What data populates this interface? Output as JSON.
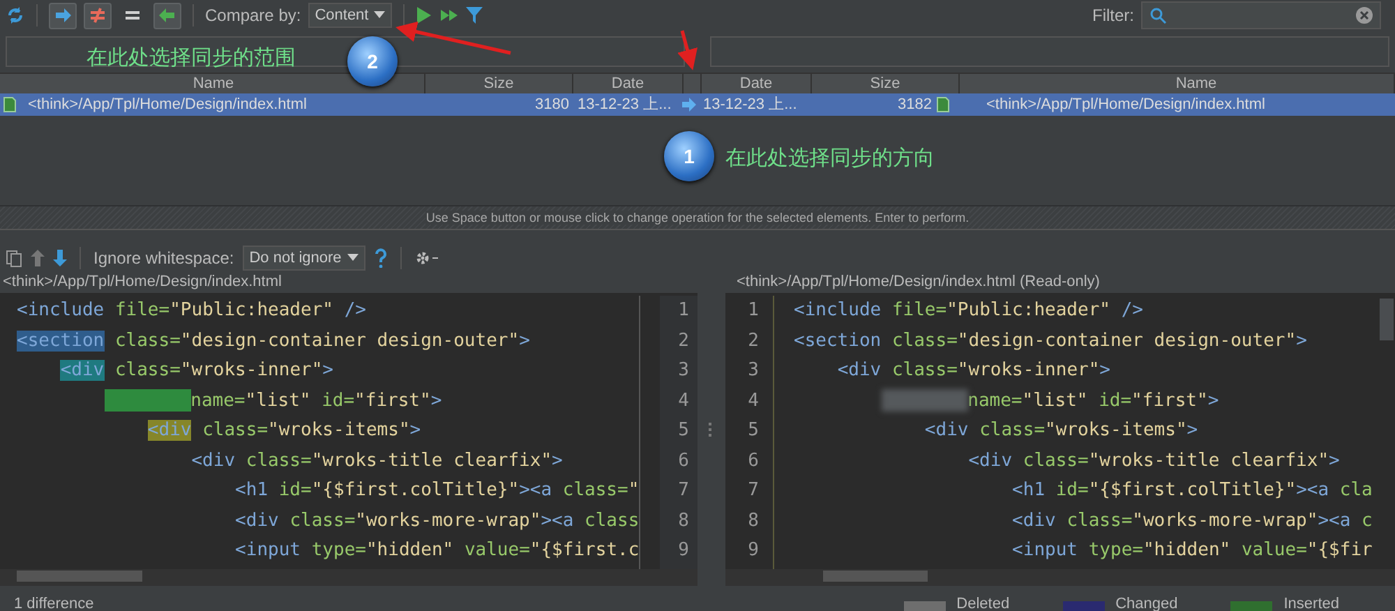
{
  "toolbar": {
    "toggles": [
      {
        "kind": "right",
        "selected": true
      },
      {
        "kind": "notequal",
        "selected": true
      },
      {
        "kind": "equal",
        "selected": false
      },
      {
        "kind": "left",
        "selected": true
      }
    ],
    "compare_label": "Compare by:",
    "compare_value": "Content",
    "filter_label": "Filter:"
  },
  "annotations": [
    {
      "number": "2",
      "text": "在此处选择同步的范围"
    },
    {
      "number": "1",
      "text": "在此处选择同步的方向"
    }
  ],
  "table": {
    "columns": [
      "Name",
      "Size",
      "Date",
      "Date",
      "Size",
      "Name"
    ],
    "rows": [
      {
        "left_name": "<think>/App/Tpl/Home/Design/index.html",
        "left_size": "3180",
        "left_date": "13-12-23 上...",
        "right_date": "13-12-23 上...",
        "right_size": "3182",
        "right_name": "<think>/App/Tpl/Home/Design/index.html",
        "selected": true
      }
    ]
  },
  "hint": "Use Space button or mouse click to change operation for the selected elements. Enter to perform.",
  "diff_toolbar": {
    "ignore_label": "Ignore whitespace:",
    "ignore_value": "Do not ignore"
  },
  "editors": [
    {
      "title": "<think>/App/Tpl/Home/Design/index.html",
      "lines": [
        {
          "number": "1",
          "text": "<include file=\"Public:header\" />"
        },
        {
          "number": "2",
          "text": "<section class=\"design-container design-outer\">",
          "color": "#2f5d8c"
        },
        {
          "number": "3",
          "text": "    <div class=\"wroks-inner\">",
          "color": "#1f7a80"
        },
        {
          "number": "4",
          "text": "        name=\"list\" id=\"first\">",
          "blurred": true,
          "color": "#2e8b3e"
        },
        {
          "number": "5",
          "text": "            <div class=\"wroks-items\">",
          "color": "#86862a"
        },
        {
          "number": "6",
          "text": "                <div class=\"wroks-title clearfix\">"
        },
        {
          "number": "7",
          "text": "                    <h1 id=\"{$first.colTitle}\"><a class=\""
        },
        {
          "number": "8",
          "text": "                    <div class=\"works-more-wrap\"><a class"
        },
        {
          "number": "9",
          "text": "                    <input type=\"hidden\" value=\"{$first.c"
        }
      ]
    },
    {
      "title": "<think>/App/Tpl/Home/Design/index.html (Read-only)",
      "lines": [
        {
          "number": "1",
          "text": "<include file=\"Public:header\" />"
        },
        {
          "number": "2",
          "text": "<section class=\"design-container design-outer\">"
        },
        {
          "number": "3",
          "text": "    <div class=\"wroks-inner\">"
        },
        {
          "number": "4",
          "text": "        name=\"list\" id=\"first\">",
          "blurred": true
        },
        {
          "number": "5",
          "text": "            <div class=\"wroks-items\">"
        },
        {
          "number": "6",
          "text": "                <div class=\"wroks-title clearfix\">"
        },
        {
          "number": "7",
          "text": "                    <h1 id=\"{$first.colTitle}\"><a cla"
        },
        {
          "number": "8",
          "text": "                    <div class=\"works-more-wrap\"><a c"
        },
        {
          "number": "9",
          "text": "                    <input type=\"hidden\" value=\"{$fir"
        }
      ]
    }
  ],
  "status": {
    "diff_count": "1 difference",
    "legend": [
      {
        "label": "Deleted",
        "color": "#6e6e6e"
      },
      {
        "label": "Changed",
        "color": "#2a2a70"
      },
      {
        "label": "Inserted",
        "color": "#2f6f2f"
      }
    ]
  }
}
